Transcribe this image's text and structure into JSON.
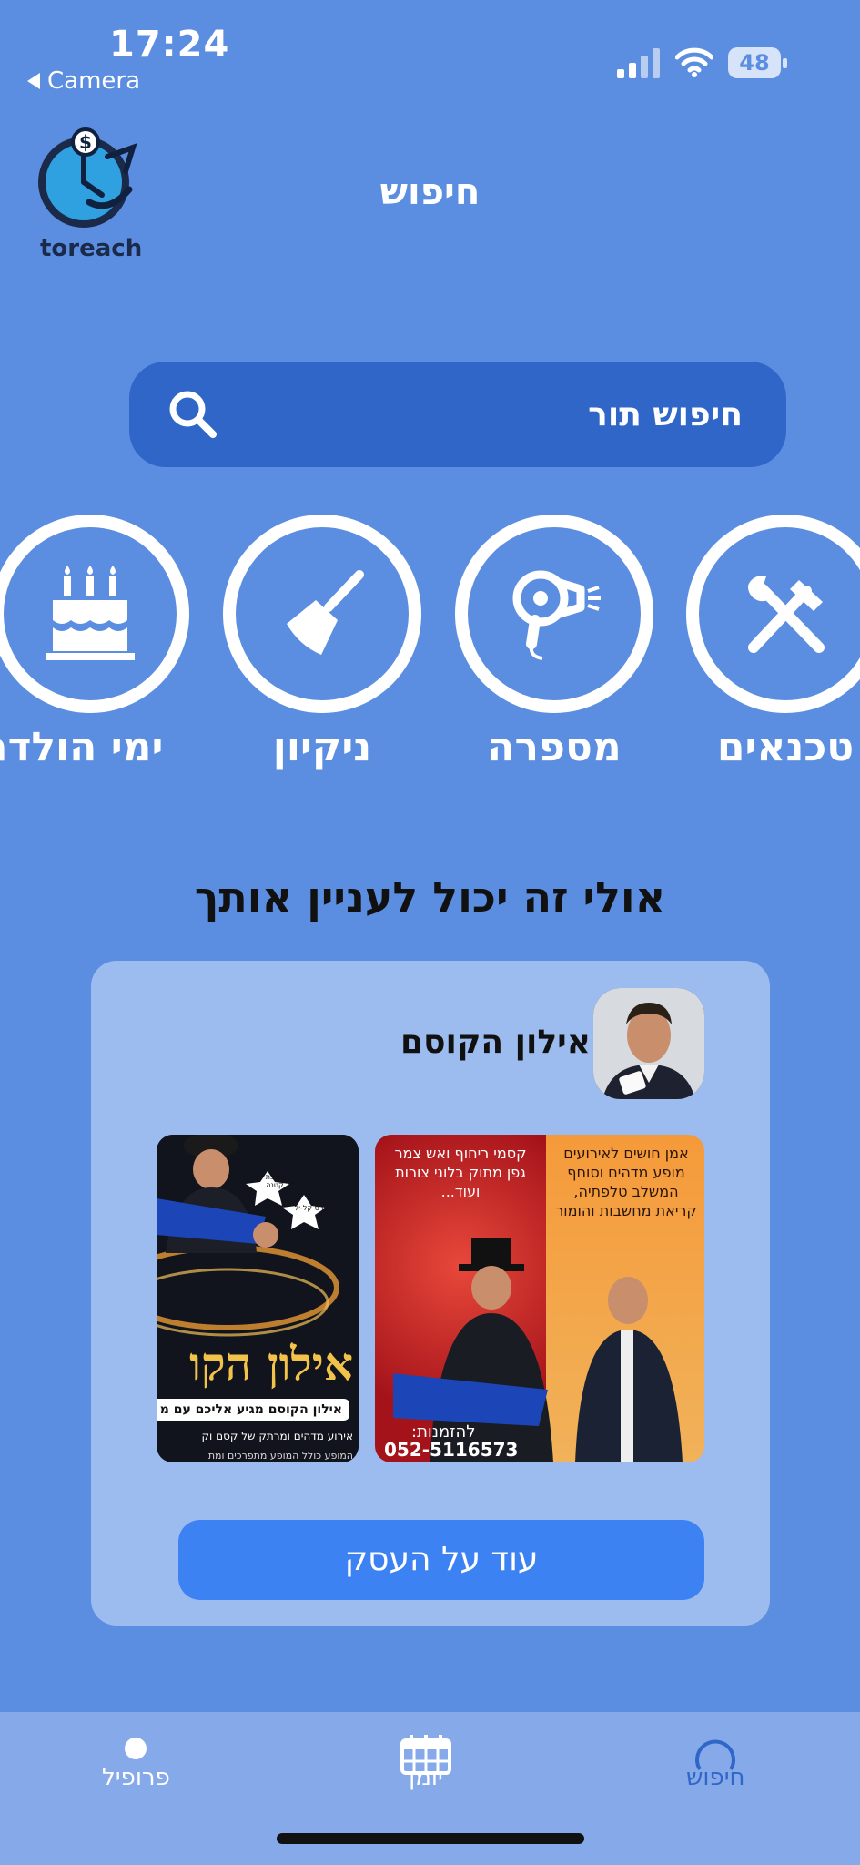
{
  "status": {
    "time": "17:24",
    "back_label": "Camera",
    "battery": "48"
  },
  "header": {
    "logo_text": "toreach",
    "title": "חיפוש"
  },
  "search": {
    "label": "חיפוש תור"
  },
  "categories": [
    {
      "label": "טכנאים",
      "icon": "tools-icon"
    },
    {
      "label": "מספרה",
      "icon": "hair-dryer-icon"
    },
    {
      "label": "ניקיון",
      "icon": "broom-icon"
    },
    {
      "label": "ימי הולדת",
      "icon": "birthday-cake-icon"
    }
  ],
  "suggestions": {
    "title": "אולי זה יכול לעניין אותך",
    "card": {
      "name": "אילון הקוסם",
      "poster1": {
        "left_text": "קסמי ריחוף ואש צמר גפן מתוק בלוני צורות ועוד...",
        "right_text": "אמן חושים לאירועים מופע מדהים וסוחף המשלב טלפתיה, קריאת מחשבות והומור",
        "phone_label": "להזמנות:",
        "phone": "052-5116573"
      },
      "poster2": {
        "headline": "אילון הקו",
        "banner": "אילון הקוסם מגיע אליכם עם מ",
        "line1": "אירוע מדהים ומרתק של קסם וק",
        "line2": "המופע כולל המופע מתפרכים ומת",
        "star1": "כוכבת קטנה",
        "star2": "פרס קל-יל"
      },
      "button": "עוד על העסק"
    }
  },
  "tabs": [
    {
      "label": "פרופיל",
      "icon": "profile-icon"
    },
    {
      "label": "יומן",
      "icon": "calendar-icon"
    },
    {
      "label": "חיפוש",
      "icon": "search-tab-icon"
    }
  ],
  "colors": {
    "background": "#5b8ee0",
    "search_bar": "#2f66c8",
    "card": "#9cbbee",
    "button": "#3d82f2",
    "tabbar": "#86a9ea",
    "active_tab": "#2f66c8"
  }
}
